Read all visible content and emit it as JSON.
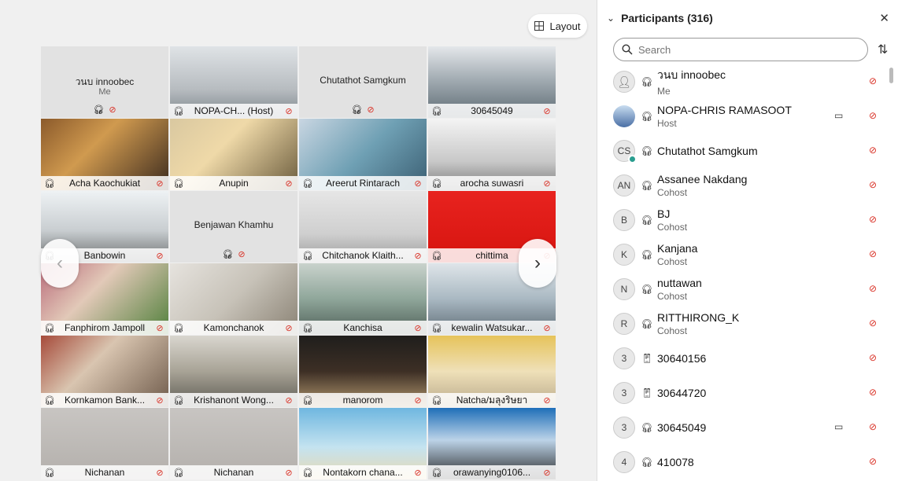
{
  "layout_label": "Layout",
  "tiles": [
    {
      "name": "วนบ innoobec",
      "sub": "Me",
      "mode": "avatar",
      "scene": "#e2e2e2"
    },
    {
      "name": "NOPA-CH... (Host)",
      "mode": "video",
      "scene": "linear-gradient(#dfe3e6,#b7bcc0 60%,#7d868c)"
    },
    {
      "name": "Chutathot Samgkum",
      "mode": "avatar",
      "scene": "#e2e2e2"
    },
    {
      "name": "30645049",
      "mode": "video",
      "scene": "linear-gradient(#e4e7ea,#9da7ae 50%,#5d6a72)"
    },
    {
      "name": "Acha Kaochukiat",
      "mode": "video",
      "scene": "linear-gradient(135deg,#8b5a2b,#d09a4f 40%,#3b2a1e)"
    },
    {
      "name": "Anupin",
      "mode": "video",
      "scene": "linear-gradient(135deg,#d9c8a0,#efd9a8 40%,#6a5b3c)"
    },
    {
      "name": "Areerut Rintarach",
      "mode": "video",
      "scene": "linear-gradient(135deg,#c9d6e2,#6fa0b4 50%,#3b5f73)"
    },
    {
      "name": "arocha suwasri",
      "mode": "video",
      "scene": "linear-gradient(#f4f4f4,#c8c8c8 60%,#7a7a7a)"
    },
    {
      "name": "Banbowin",
      "mode": "video",
      "scene": "linear-gradient(#eef2f4,#c9ced1 55%,#6c6f70)"
    },
    {
      "name": "Benjawan Khamhu",
      "mode": "avatar",
      "scene": "#e2e2e2"
    },
    {
      "name": "Chitchanok Klaith...",
      "mode": "video",
      "scene": "linear-gradient(#e6e6e6,#cfcfcf 60%,#9c9c9c)"
    },
    {
      "name": "chittima",
      "mode": "video",
      "scene": "linear-gradient(#e8231f,#d6140f)"
    },
    {
      "name": "Fanphirom Jampoll",
      "mode": "video",
      "scene": "linear-gradient(135deg,#b96a7a,#e2c9b8 40%,#4f7f3a)"
    },
    {
      "name": "Kamonchanok",
      "mode": "video",
      "scene": "linear-gradient(135deg,#e6e3de,#c7c2b8 50%,#8a8274)"
    },
    {
      "name": "Kanchisa",
      "mode": "video",
      "scene": "linear-gradient(#c9d2cc,#8fa69a 50%,#4e5f57)"
    },
    {
      "name": "kewalin Watsukar...",
      "mode": "video",
      "scene": "linear-gradient(#dfe5e9,#a9b8c2 50%,#5e6c75)"
    },
    {
      "name": "Kornkamon Bank...",
      "mode": "video",
      "scene": "linear-gradient(135deg,#a64a3a,#d9c5b0 40%,#6e5a4a)"
    },
    {
      "name": "Krishanont Wong...",
      "mode": "video",
      "scene": "linear-gradient(#d9d6cf,#a8a396 50%,#5c5a52)"
    },
    {
      "name": "manorom",
      "mode": "video",
      "scene": "linear-gradient(#1f1e1c,#3d2f25 50%,#b59a70)"
    },
    {
      "name": "Natcha/มลุงริษยา",
      "mode": "video",
      "scene": "linear-gradient(#e6c35a,#efe0b8 50%,#b8a98a)"
    },
    {
      "name": "Nichanan",
      "mode": "video",
      "scene": "linear-gradient(#c8c5c2,#b3afab)"
    },
    {
      "name": "Nichanan",
      "mode": "video",
      "scene": "linear-gradient(#c8c5c2,#b3afab)"
    },
    {
      "name": "Nontakorn chana...",
      "mode": "video",
      "scene": "linear-gradient(#6fb7e0,#c4e3f0 55%,#e9d8b0)"
    },
    {
      "name": "orawanying0106...",
      "mode": "video",
      "scene": "linear-gradient(#1f6fb8,#bcd3e8 45%,#2a2a2a)"
    }
  ],
  "panel": {
    "title": "Participants (316)",
    "search_placeholder": "Search",
    "participants": [
      {
        "name": "วนบ innoobec",
        "role": "Me",
        "avatar": "",
        "audio": "headset",
        "camera": false
      },
      {
        "name": "NOPA-CHRIS RAMASOOT",
        "role": "Host",
        "avatar": "photo",
        "audio": "headset",
        "camera": true
      },
      {
        "name": "Chutathot Samgkum",
        "role": "",
        "avatar": "CS",
        "audio": "headset",
        "camera": false
      },
      {
        "name": "Assanee Nakdang",
        "role": "Cohost",
        "avatar": "AN",
        "audio": "headset",
        "camera": false
      },
      {
        "name": "BJ",
        "role": "Cohost",
        "avatar": "B",
        "audio": "headset",
        "camera": false
      },
      {
        "name": "Kanjana",
        "role": "Cohost",
        "avatar": "K",
        "audio": "headset",
        "camera": false
      },
      {
        "name": "nuttawan",
        "role": "Cohost",
        "avatar": "N",
        "audio": "headset",
        "camera": false
      },
      {
        "name": "RITTHIRONG_K",
        "role": "Cohost",
        "avatar": "R",
        "audio": "headset",
        "camera": false
      },
      {
        "name": "30640156",
        "role": "",
        "avatar": "3",
        "audio": "phone",
        "camera": false
      },
      {
        "name": "30644720",
        "role": "",
        "avatar": "3",
        "audio": "phone",
        "camera": false
      },
      {
        "name": "30645049",
        "role": "",
        "avatar": "3",
        "audio": "headset",
        "camera": true
      },
      {
        "name": "410078",
        "role": "",
        "avatar": "4",
        "audio": "headset",
        "camera": false
      }
    ]
  }
}
